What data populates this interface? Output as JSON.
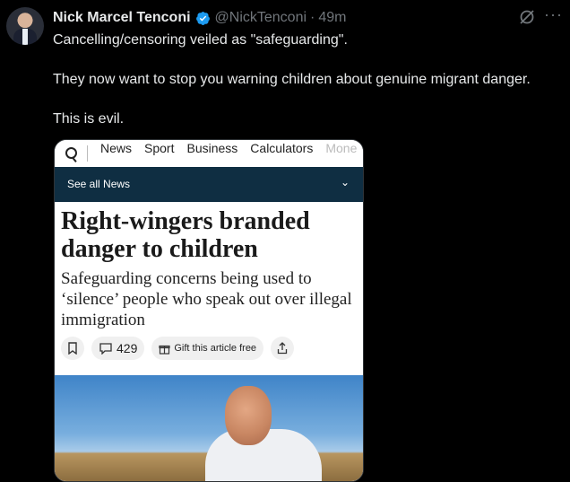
{
  "tweet": {
    "author_name": "Nick Marcel Tenconi",
    "handle": "@NickTenconi",
    "separator": "·",
    "time": "49m",
    "more_label": "···",
    "verified_color": "#1d9bf0",
    "paragraphs": [
      "Cancelling/censoring veiled as \"safeguarding\".",
      "They now want to stop you warning children about genuine migrant danger.",
      "This is evil."
    ]
  },
  "article": {
    "nav_items": [
      "News",
      "Sport",
      "Business",
      "Calculators",
      "Mone"
    ],
    "subnav_label": "See all News",
    "headline": "Right-wingers branded danger to children",
    "standfirst": "Safeguarding concerns being used to ‘silence’ people who speak out over illegal immigration",
    "comment_count": "429",
    "gift_label": "Gift this article free",
    "header_color": "#0f2e42",
    "icons": [
      "search-icon",
      "chevron-down-icon",
      "bookmark-icon",
      "comment-icon",
      "gift-icon",
      "share-icon"
    ]
  }
}
